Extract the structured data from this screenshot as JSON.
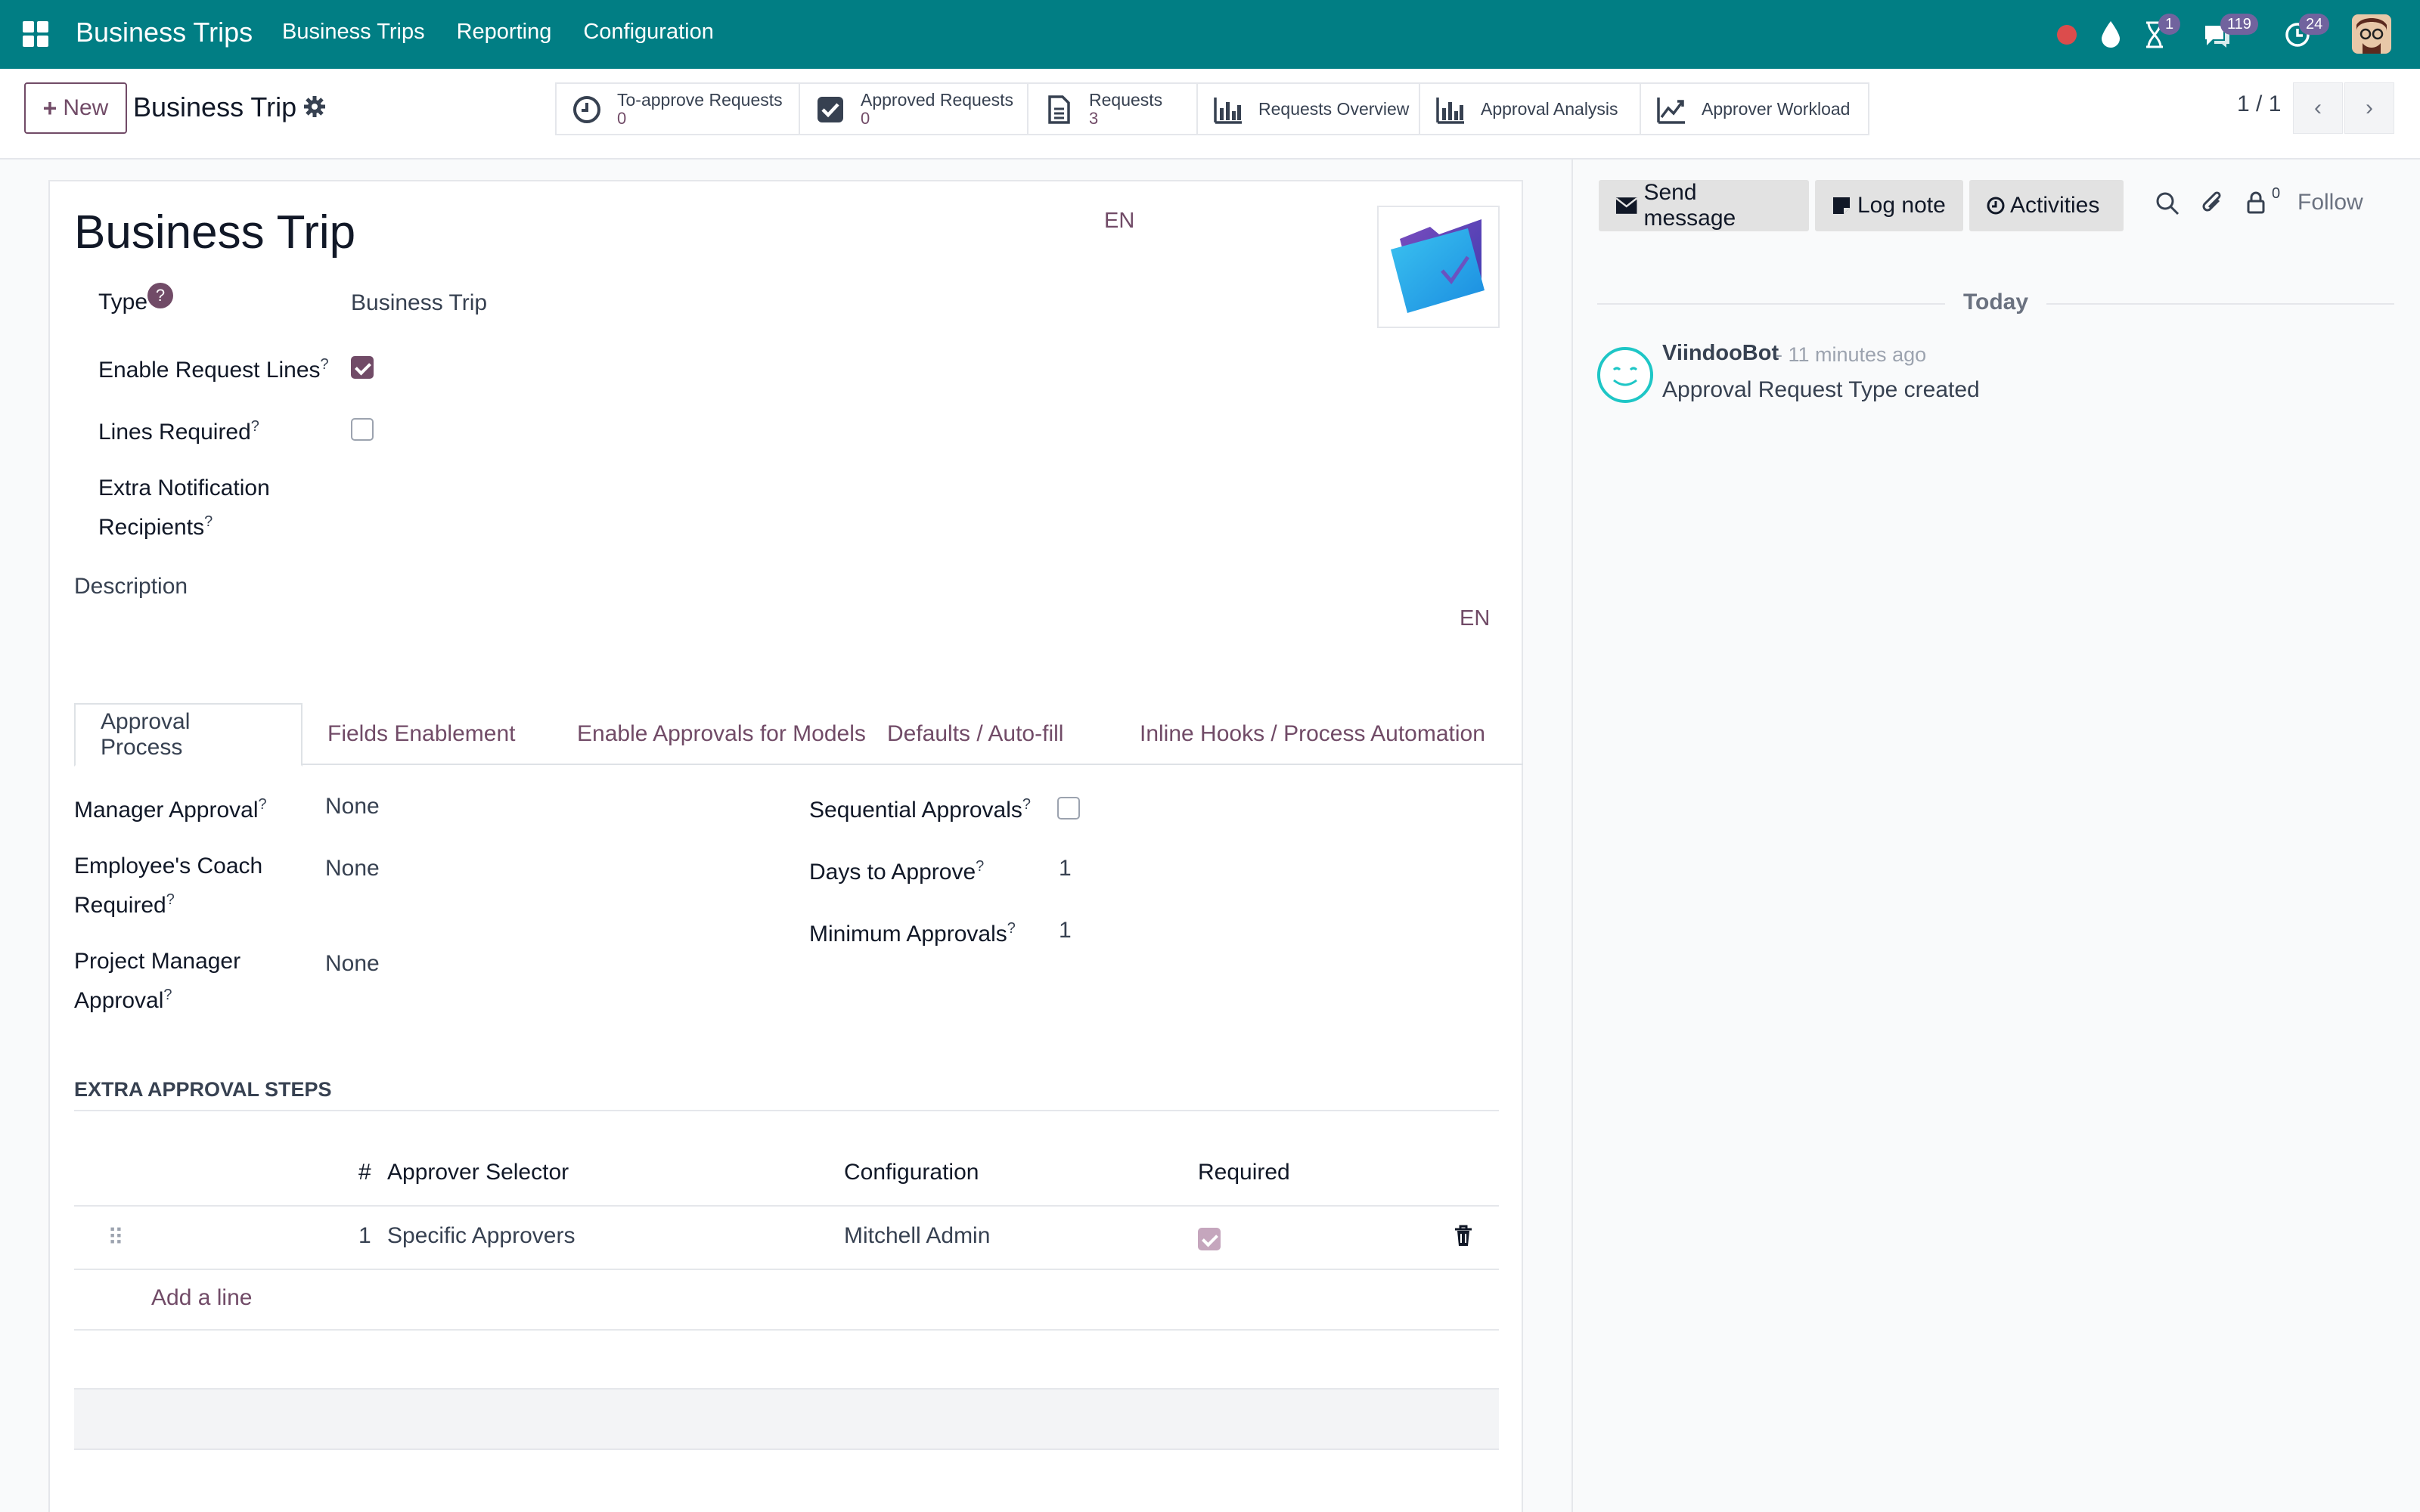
{
  "navbar": {
    "app_name": "Business Trips",
    "menus": [
      "Business Trips",
      "Reporting",
      "Configuration"
    ],
    "badges": {
      "activities": "1",
      "messages": "119",
      "calls": "24"
    },
    "color": "#017e84"
  },
  "control_panel": {
    "new_label": "New",
    "breadcrumb": "Business Trip",
    "smart_buttons": [
      {
        "label": "To-approve Requests",
        "count": "0",
        "icon": "clock-icon"
      },
      {
        "label": "Approved Requests",
        "count": "0",
        "icon": "checkbox-icon"
      },
      {
        "label": "Requests",
        "count": "3",
        "icon": "document-icon"
      },
      {
        "label": "Requests Overview",
        "count": "",
        "icon": "bar-chart-icon"
      },
      {
        "label": "Approval Analysis",
        "count": "",
        "icon": "bar-chart-icon"
      },
      {
        "label": "Approver Workload",
        "count": "",
        "icon": "line-chart-icon"
      }
    ],
    "pager": "1 / 1"
  },
  "form": {
    "title": "Business Trip",
    "lang": "EN",
    "fields": {
      "type_label": "Type",
      "type_value": "Business Trip",
      "enable_lines_label": "Enable Request Lines",
      "enable_lines_value": true,
      "lines_required_label": "Lines Required",
      "lines_required_value": false,
      "extra_notif_label_1": "Extra Notification",
      "extra_notif_label_2": "Recipients",
      "description_label": "Description"
    },
    "tabs": [
      "Approval Process",
      "Fields Enablement",
      "Enable Approvals for Models",
      "Defaults / Auto-fill",
      "Inline Hooks / Process Automation"
    ],
    "approval": {
      "manager_label": "Manager Approval",
      "manager_value": "None",
      "coach_label_1": "Employee's Coach",
      "coach_label_2": "Required",
      "coach_value": "None",
      "pm_label_1": "Project Manager",
      "pm_label_2": "Approval",
      "pm_value": "None",
      "sequential_label": "Sequential Approvals",
      "sequential_value": false,
      "days_label": "Days to Approve",
      "days_value": "1",
      "min_label": "Minimum Approvals",
      "min_value": "1"
    },
    "extra_steps": {
      "title": "EXTRA APPROVAL STEPS",
      "headers": [
        "#",
        "Approver Selector",
        "Configuration",
        "Required"
      ],
      "rows": [
        {
          "num": "1",
          "selector": "Specific Approvers",
          "configuration": "Mitchell Admin",
          "required": true
        }
      ],
      "add_line": "Add a line"
    }
  },
  "chatter": {
    "send_message": "Send message",
    "log_note": "Log note",
    "activities": "Activities",
    "followers_count": "0",
    "follow": "Follow",
    "today": "Today",
    "message": {
      "author": "ViindooBot",
      "time": "- 11 minutes ago",
      "body": "Approval Request Type created"
    }
  }
}
